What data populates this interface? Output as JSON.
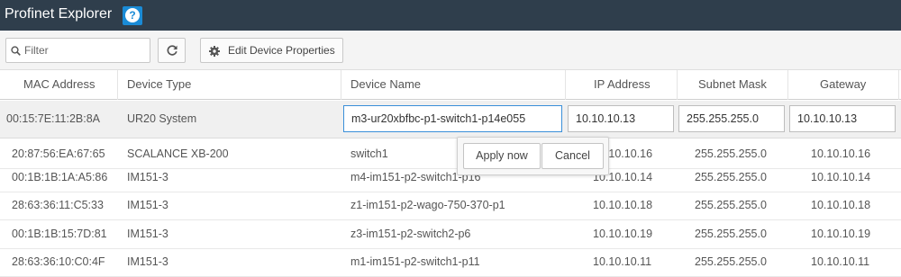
{
  "app": {
    "title": "Profinet Explorer",
    "help_icon": "question-circle-icon",
    "accent_color": "#1a8bd6",
    "titlebar_color": "#2f3e4c"
  },
  "toolbar": {
    "filter_placeholder": "Filter",
    "filter_value": "",
    "search_icon": "search-icon",
    "refresh_icon": "refresh-icon",
    "edit_icon": "gear-icon",
    "edit_label": "Edit Device Properties"
  },
  "table": {
    "columns": [
      "MAC Address",
      "Device Type",
      "Device Name",
      "IP Address",
      "Subnet Mask",
      "Gateway"
    ],
    "selected_row": {
      "mac": "00:15:7E:11:2B:8A",
      "type": "UR20 System",
      "name": "m3-ur20xbfbc-p1-switch1-p14e055",
      "ip": "10.10.10.13",
      "subnet": "255.255.255.0",
      "gateway": "10.10.10.13"
    },
    "rows": [
      {
        "mac": "20:87:56:EA:67:65",
        "type": "SCALANCE XB-200",
        "name": "switch1",
        "ip": "10.10.10.16",
        "subnet": "255.255.255.0",
        "gateway": "10.10.10.16"
      },
      {
        "mac": "00:1B:1B:1A:A5:86",
        "type": "IM151-3",
        "name": "m4-im151-p2-switch1-p16",
        "ip": "10.10.10.14",
        "subnet": "255.255.255.0",
        "gateway": "10.10.10.14"
      },
      {
        "mac": "28:63:36:11:C5:33",
        "type": "IM151-3",
        "name": "z1-im151-p2-wago-750-370-p1",
        "ip": "10.10.10.18",
        "subnet": "255.255.255.0",
        "gateway": "10.10.10.18"
      },
      {
        "mac": "00:1B:1B:15:7D:81",
        "type": "IM151-3",
        "name": "z3-im151-p2-switch2-p6",
        "ip": "10.10.10.19",
        "subnet": "255.255.255.0",
        "gateway": "10.10.10.19"
      },
      {
        "mac": "28:63:36:10:C0:4F",
        "type": "IM151-3",
        "name": "m1-im151-p2-switch1-p11",
        "ip": "10.10.10.11",
        "subnet": "255.255.255.0",
        "gateway": "10.10.10.11"
      }
    ]
  },
  "popover": {
    "apply_label": "Apply now",
    "cancel_label": "Cancel"
  }
}
